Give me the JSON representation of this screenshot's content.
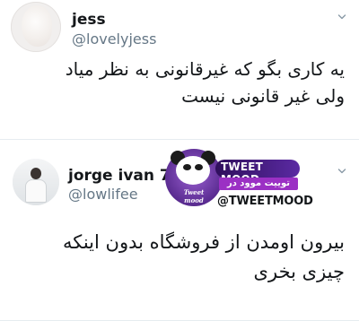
{
  "tweets": [
    {
      "display_name": "jess",
      "handle": "@lovelyjess",
      "lines": [
        "یه کاری بگو که غیرقانونی به نظر میاد",
        "ولی غیر قانونی نیست"
      ]
    },
    {
      "display_name": "jorge ivan 777",
      "handle": "@lowlifee",
      "lines": [
        "بیرون اومدن از فروشگاه بدون اینکه",
        "چیزی بخری"
      ]
    }
  ],
  "watermark": {
    "title": "TWEET MOOD",
    "subtitle": "توییت موود در ایتا",
    "handle": "@TWEETMOOD",
    "logo_text": "Tweet mood"
  },
  "colors": {
    "text_primary": "#14171a",
    "text_secondary": "#657786",
    "divider": "#e6ecf0",
    "brand_purple": "#5b2aa3"
  },
  "icons": {
    "more": "chevron-down-icon",
    "logo": "panda-logo-icon"
  }
}
